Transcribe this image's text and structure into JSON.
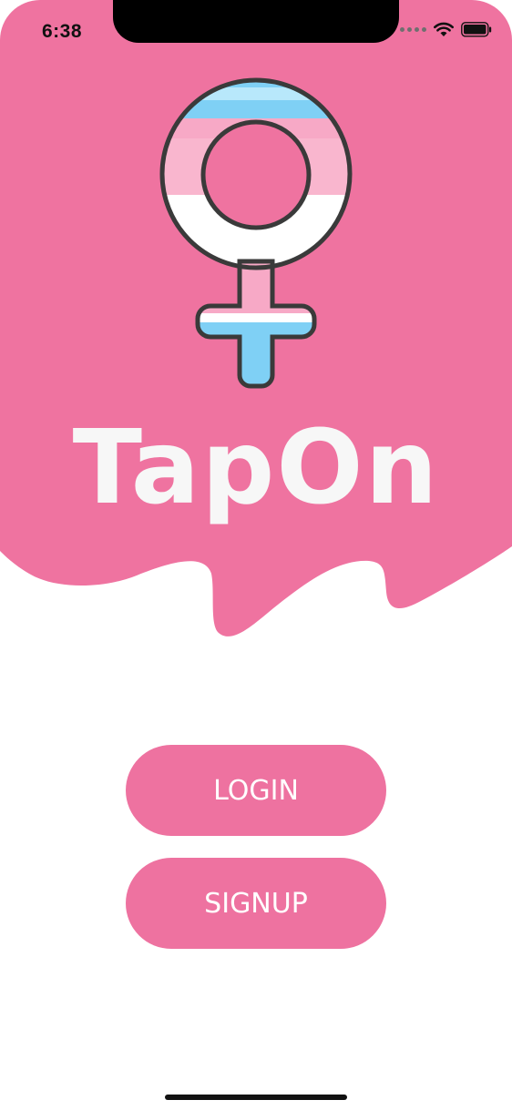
{
  "status_bar": {
    "time": "6:38",
    "icons": [
      "cellular-signal-icon",
      "wifi-icon",
      "battery-icon"
    ]
  },
  "app": {
    "title": "TapOn",
    "logo_icon": "transgender-female-symbol-icon"
  },
  "actions": {
    "login_label": "LOGIN",
    "signup_label": "SIGNUP"
  },
  "colors": {
    "brand_pink": "#ee72a0",
    "flag_blue": "#7fd0f5",
    "flag_pink": "#f7a9c6",
    "flag_white": "#ffffff",
    "title_text": "#f7f7f7",
    "background": "#ffffff"
  }
}
